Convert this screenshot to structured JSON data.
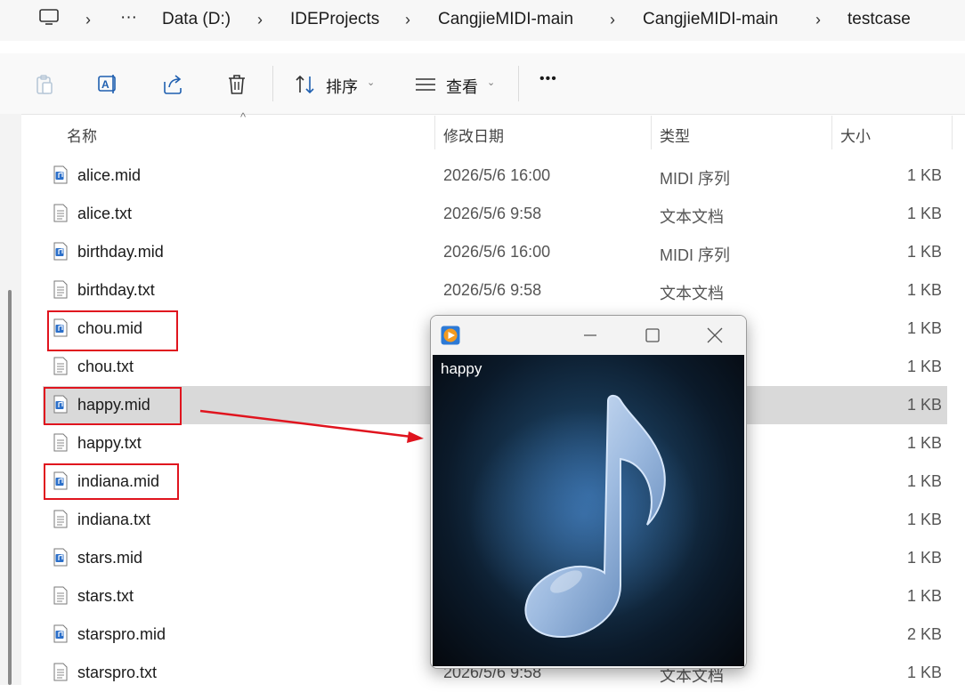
{
  "breadcrumb": {
    "items": [
      "Data (D:)",
      "IDEProjects",
      "CangjieMIDI-main",
      "CangjieMIDI-main",
      "testcase"
    ],
    "overflow": "···",
    "separator": "›"
  },
  "toolbar": {
    "sort_label": "排序",
    "view_label": "查看",
    "more_label": "•••"
  },
  "columns": {
    "name": "名称",
    "modified": "修改日期",
    "type": "类型",
    "size": "大小"
  },
  "files": [
    {
      "name": "alice.mid",
      "date": "2026/5/6 16:00",
      "type": "MIDI 序列",
      "size": "1 KB",
      "kind": "mid"
    },
    {
      "name": "alice.txt",
      "date": "2026/5/6 9:58",
      "type": "文本文档",
      "size": "1 KB",
      "kind": "txt"
    },
    {
      "name": "birthday.mid",
      "date": "2026/5/6 16:00",
      "type": "MIDI 序列",
      "size": "1 KB",
      "kind": "mid"
    },
    {
      "name": "birthday.txt",
      "date": "2026/5/6 9:58",
      "type": "文本文档",
      "size": "1 KB",
      "kind": "txt"
    },
    {
      "name": "chou.mid",
      "date": "",
      "type": "",
      "size": "1 KB",
      "kind": "mid"
    },
    {
      "name": "chou.txt",
      "date": "",
      "type": "",
      "size": "1 KB",
      "kind": "txt"
    },
    {
      "name": "happy.mid",
      "date": "",
      "type": "",
      "size": "1 KB",
      "kind": "mid"
    },
    {
      "name": "happy.txt",
      "date": "",
      "type": "",
      "size": "1 KB",
      "kind": "txt"
    },
    {
      "name": "indiana.mid",
      "date": "",
      "type": "",
      "size": "1 KB",
      "kind": "mid"
    },
    {
      "name": "indiana.txt",
      "date": "",
      "type": "",
      "size": "1 KB",
      "kind": "txt"
    },
    {
      "name": "stars.mid",
      "date": "",
      "type": "",
      "size": "1 KB",
      "kind": "mid"
    },
    {
      "name": "stars.txt",
      "date": "",
      "type": "",
      "size": "1 KB",
      "kind": "txt"
    },
    {
      "name": "starspro.mid",
      "date": "",
      "type": "",
      "size": "2 KB",
      "kind": "mid"
    },
    {
      "name": "starspro.txt",
      "date": "2026/5/6 9:58",
      "type": "文本文档",
      "size": "1 KB",
      "kind": "txt"
    }
  ],
  "selected_file": "happy.mid",
  "highlighted_files": [
    "chou.mid",
    "happy.mid",
    "indiana.mid"
  ],
  "player": {
    "track_title": "happy",
    "icons": [
      "media-player-app-icon",
      "minimize-icon",
      "maximize-icon",
      "close-icon",
      "music-note-icon"
    ]
  },
  "colors": {
    "highlight_box": "#e0141e",
    "selection": "#d9d9d9",
    "accent": "#1f6fd6"
  }
}
